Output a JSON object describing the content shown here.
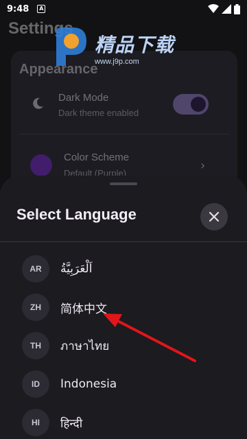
{
  "status_bar": {
    "time": "9:48",
    "notification_icon": "a-letter-icon",
    "icons": [
      "wifi-icon",
      "signal-icon",
      "battery-icon"
    ]
  },
  "background_page": {
    "title": "Settings",
    "section_title": "Appearance",
    "dark_mode": {
      "label": "Dark Mode",
      "subtitle": "Dark theme enabled",
      "enabled": true
    },
    "color_scheme": {
      "label": "Color Scheme",
      "subtitle": "Default (Purple)",
      "swatch_color": "#7b2bd6"
    }
  },
  "watermark": {
    "title": "精品下载",
    "url": "www.j9p.com"
  },
  "sheet": {
    "title": "Select Language",
    "close_icon": "close-icon",
    "languages": [
      {
        "code": "AR",
        "name": "اَلْعَرَبِيَّةُ"
      },
      {
        "code": "ZH",
        "name": "简体中文"
      },
      {
        "code": "TH",
        "name": "ภาษาไทย"
      },
      {
        "code": "ID",
        "name": "Indonesia"
      },
      {
        "code": "HI",
        "name": "हिन्दी"
      }
    ]
  },
  "colors": {
    "accent": "#9b86d8",
    "sheet_background": "#1c1b1f",
    "annotation_arrow": "#e0161b"
  }
}
